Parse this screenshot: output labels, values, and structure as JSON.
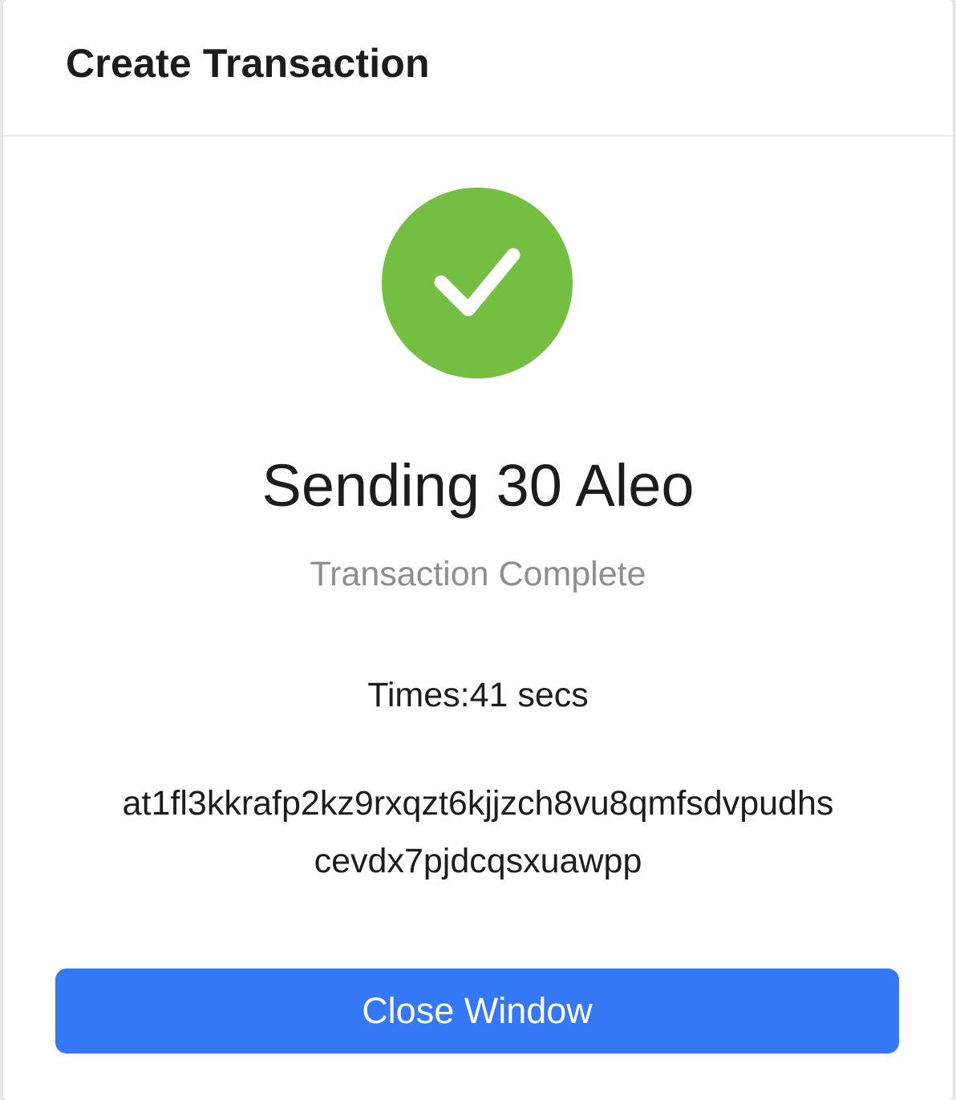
{
  "window": {
    "title": "Create Transaction"
  },
  "status": {
    "icon": "checkmark-icon",
    "icon_color": "#74bf41",
    "amount_text": "Sending 30 Aleo",
    "status_text": "Transaction Complete",
    "time_text": "Times:41 secs",
    "transaction_id_line1": "at1fl3kkrafp2kz9rxqzt6kjjzch8vu8qmfsdvpudhs",
    "transaction_id_line2": "cevdx7pjdcqsxuawpp"
  },
  "actions": {
    "close_label": "Close Window",
    "button_color": "#3478f6"
  }
}
